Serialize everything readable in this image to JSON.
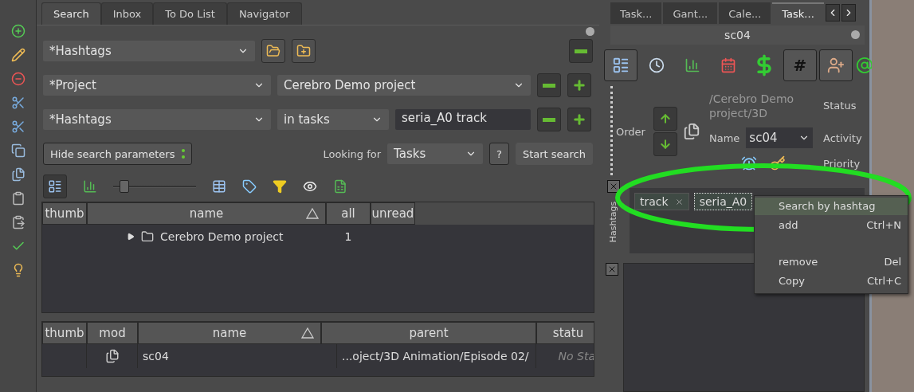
{
  "tabs": [
    {
      "label": "Search",
      "selected": true
    },
    {
      "label": "Inbox",
      "selected": false
    },
    {
      "label": "To Do List",
      "selected": false
    },
    {
      "label": "Navigator",
      "selected": false
    }
  ],
  "search": {
    "preset": "*Hashtags",
    "criteria": [
      {
        "field": "*Project",
        "value": "Cerebro Demo project",
        "kind": "combo"
      },
      {
        "field": "*Hashtags",
        "mode": "in tasks",
        "value": "seria_A0 track",
        "kind": "text"
      }
    ],
    "hide_button": "Hide search parameters",
    "looking_for_label": "Looking for",
    "looking_for": "Tasks",
    "help": "?",
    "start_button": "Start search"
  },
  "zoom_slider": {
    "level": 0.08
  },
  "upper_table": {
    "columns": [
      {
        "label": "thumb",
        "sorted": false
      },
      {
        "label": "name",
        "sorted": true
      },
      {
        "label": "all",
        "sorted": false
      },
      {
        "label": "unread",
        "sorted": false
      }
    ],
    "rows": [
      {
        "name": "Cerebro Demo project",
        "all": "1",
        "expanded": false
      }
    ]
  },
  "lower_table": {
    "columns": [
      {
        "label": "thumb",
        "sorted": false
      },
      {
        "label": "mod",
        "sorted": false
      },
      {
        "label": "name",
        "sorted": true
      },
      {
        "label": "parent",
        "sorted": false
      },
      {
        "label": "statu",
        "sorted": false
      }
    ],
    "rows": [
      {
        "name": "sc04",
        "parent": "...oject/3D Animation/Episode 02/",
        "status": "No Sta"
      }
    ]
  },
  "right_tabs": [
    {
      "label": "Task...",
      "selected": false
    },
    {
      "label": "Gant...",
      "selected": false
    },
    {
      "label": "Cale...",
      "selected": false
    },
    {
      "label": "Task...",
      "selected": true
    }
  ],
  "task_title": "sc04",
  "task_toolbar": [
    {
      "kind": "card",
      "on": true
    },
    {
      "kind": "clock",
      "on": false
    },
    {
      "kind": "chart",
      "on": false
    },
    {
      "kind": "calendar",
      "on": false
    },
    {
      "kind": "dollar",
      "on": false
    },
    {
      "kind": "hash",
      "label": "#",
      "on": true
    },
    {
      "kind": "person",
      "on": true
    },
    {
      "kind": "at",
      "on": false
    }
  ],
  "task": {
    "path": "/Cerebro Demo project/3D",
    "order_label": "Order",
    "name_label": "Name",
    "name": "sc04",
    "status_label": "Status",
    "activity_label": "Activity",
    "priority_label": "Priority"
  },
  "hashtags": {
    "label": "Hashtags",
    "tags": [
      {
        "label": "track",
        "selected": false
      },
      {
        "label": "seria_A0",
        "selected": true
      }
    ]
  },
  "context_menu": [
    {
      "label": "Search by hashtag",
      "selected": true
    },
    {
      "label": "add",
      "shortcut": "Ctrl+N",
      "selected": false
    },
    {
      "label": "remove",
      "shortcut": "Del",
      "selected": false
    },
    {
      "label": "Copy",
      "shortcut": "Ctrl+C",
      "selected": false
    }
  ]
}
